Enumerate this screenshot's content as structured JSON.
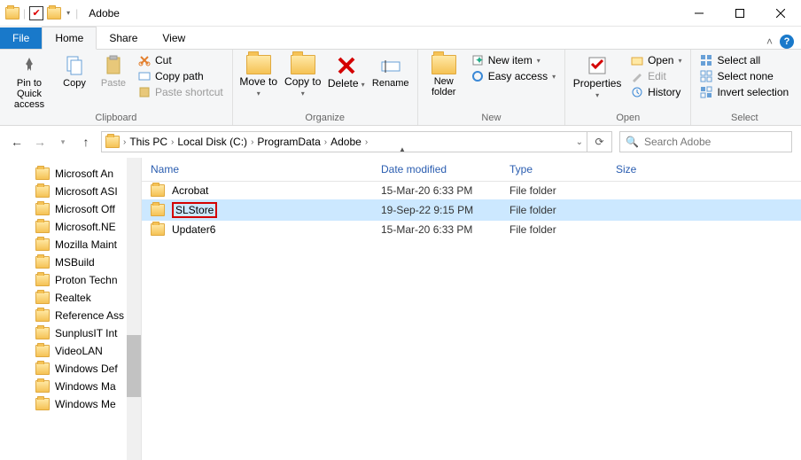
{
  "window": {
    "title": "Adobe"
  },
  "tabs": {
    "file": "File",
    "home": "Home",
    "share": "Share",
    "view": "View"
  },
  "ribbon": {
    "clipboard": {
      "label": "Clipboard",
      "pin": "Pin to Quick access",
      "copy": "Copy",
      "paste": "Paste",
      "cut": "Cut",
      "copypath": "Copy path",
      "shortcut": "Paste shortcut"
    },
    "organize": {
      "label": "Organize",
      "moveto": "Move to",
      "copyto": "Copy to",
      "delete": "Delete",
      "rename": "Rename"
    },
    "new": {
      "label": "New",
      "newfolder": "New folder",
      "newitem": "New item",
      "easyaccess": "Easy access"
    },
    "open": {
      "label": "Open",
      "properties": "Properties",
      "open": "Open",
      "edit": "Edit",
      "history": "History"
    },
    "select": {
      "label": "Select",
      "all": "Select all",
      "none": "Select none",
      "invert": "Invert selection"
    }
  },
  "breadcrumbs": [
    "This PC",
    "Local Disk (C:)",
    "ProgramData",
    "Adobe"
  ],
  "search_placeholder": "Search Adobe",
  "columns": {
    "name": "Name",
    "date": "Date modified",
    "type": "Type",
    "size": "Size"
  },
  "rows": [
    {
      "name": "Acrobat",
      "date": "15-Mar-20 6:33 PM",
      "type": "File folder",
      "selected": false,
      "highlight": false
    },
    {
      "name": "SLStore",
      "date": "19-Sep-22 9:15 PM",
      "type": "File folder",
      "selected": true,
      "highlight": true
    },
    {
      "name": "Updater6",
      "date": "15-Mar-20 6:33 PM",
      "type": "File folder",
      "selected": false,
      "highlight": false
    }
  ],
  "tree": [
    "Microsoft An",
    "Microsoft ASI",
    "Microsoft Off",
    "Microsoft.NE",
    "Mozilla Maint",
    "MSBuild",
    "Proton Techn",
    "Realtek",
    "Reference Ass",
    "SunplusIT Int",
    "VideoLAN",
    "Windows Def",
    "Windows Ma",
    "Windows Me"
  ]
}
